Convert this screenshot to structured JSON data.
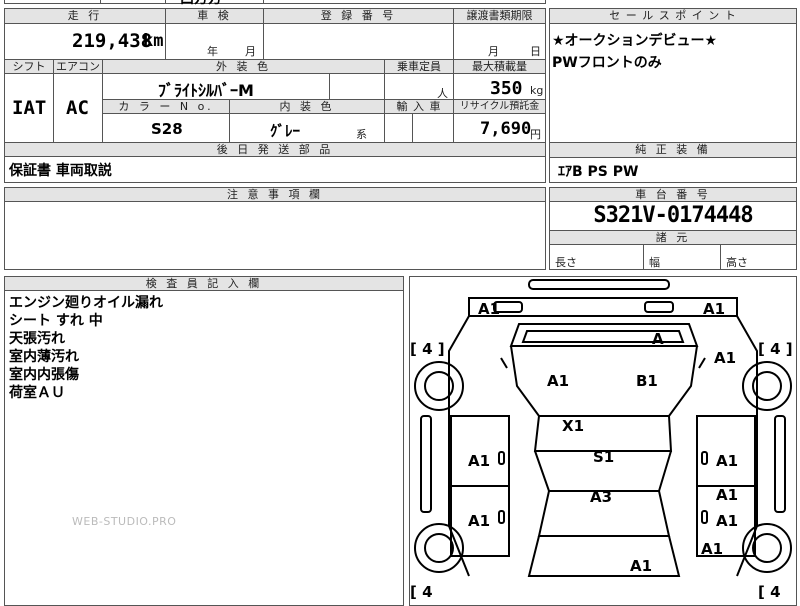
{
  "top": {
    "partial_text": "西方方"
  },
  "mileage": {
    "header": "走 行",
    "value": "219,438",
    "unit": "km"
  },
  "inspection": {
    "header": "車 検",
    "year_unit": "年",
    "month_unit": "月"
  },
  "registration": {
    "header": "登 録 番 号"
  },
  "transfer_deadline": {
    "header": "譲渡書類期限",
    "month_unit": "月",
    "day_unit": "日"
  },
  "spec_headers": {
    "shift": "シフト",
    "aircon": "エアコン",
    "exterior_color": "外 装 色",
    "capacity": "乗車定員",
    "max_load": "最大積載量"
  },
  "shift": {
    "value": "IAT"
  },
  "aircon": {
    "value": "AC"
  },
  "exterior": {
    "value": "ﾌﾞﾗｲﾄｼﾙﾊﾞｰM"
  },
  "capacity": {
    "unit": "人"
  },
  "max_load": {
    "value": "350",
    "unit": "kg"
  },
  "spec_headers2": {
    "color_no": "カ ラ ー N o.",
    "interior_color": "内 装 色",
    "import": "輸 入 車",
    "recycle": "リサイクル預託金"
  },
  "color_no": {
    "value": "S28"
  },
  "interior": {
    "value": "ｸﾞﾚｰ",
    "suffix": "系"
  },
  "recycle": {
    "value": "7,690",
    "unit": "円"
  },
  "later_parts": {
    "header": "後 日 発 送 部 品",
    "value": "保証書 車両取説"
  },
  "sales_points": {
    "header": "セ ー ル ス ポ イ ン ト",
    "lines": [
      "★オークションデビュー★",
      "PWフロントのみ"
    ]
  },
  "equipment": {
    "header": "純 正 装 備",
    "value": "ｴｱB PS PW"
  },
  "notes": {
    "header": "注 意 事 項 欄"
  },
  "chassis": {
    "header": "車 台 番 号",
    "value": "S321V-0174448"
  },
  "dimensions": {
    "header": "諸 元",
    "length": "長さ",
    "width": "幅",
    "height": "高さ"
  },
  "inspector": {
    "header": "検 査 員 記 入 欄",
    "lines": [
      "エンジン廻りオイル漏れ",
      "シート すれ 中",
      "天張汚れ",
      "室内薄汚れ",
      "室内内張傷",
      "荷室ＡＵ"
    ]
  },
  "watermark": "WEB-STUDIO.PRO",
  "diagram": {
    "tire_labels": [
      "[ 4 ]",
      "[ 4 ]",
      "[ 4",
      "[ 4"
    ],
    "marks": [
      "A1",
      "A1",
      "A",
      "A1",
      "B1",
      "A1",
      "X1",
      "S1",
      "A1",
      "A1",
      "A3",
      "A1",
      "A1",
      "A1",
      "A1",
      "A1"
    ]
  }
}
